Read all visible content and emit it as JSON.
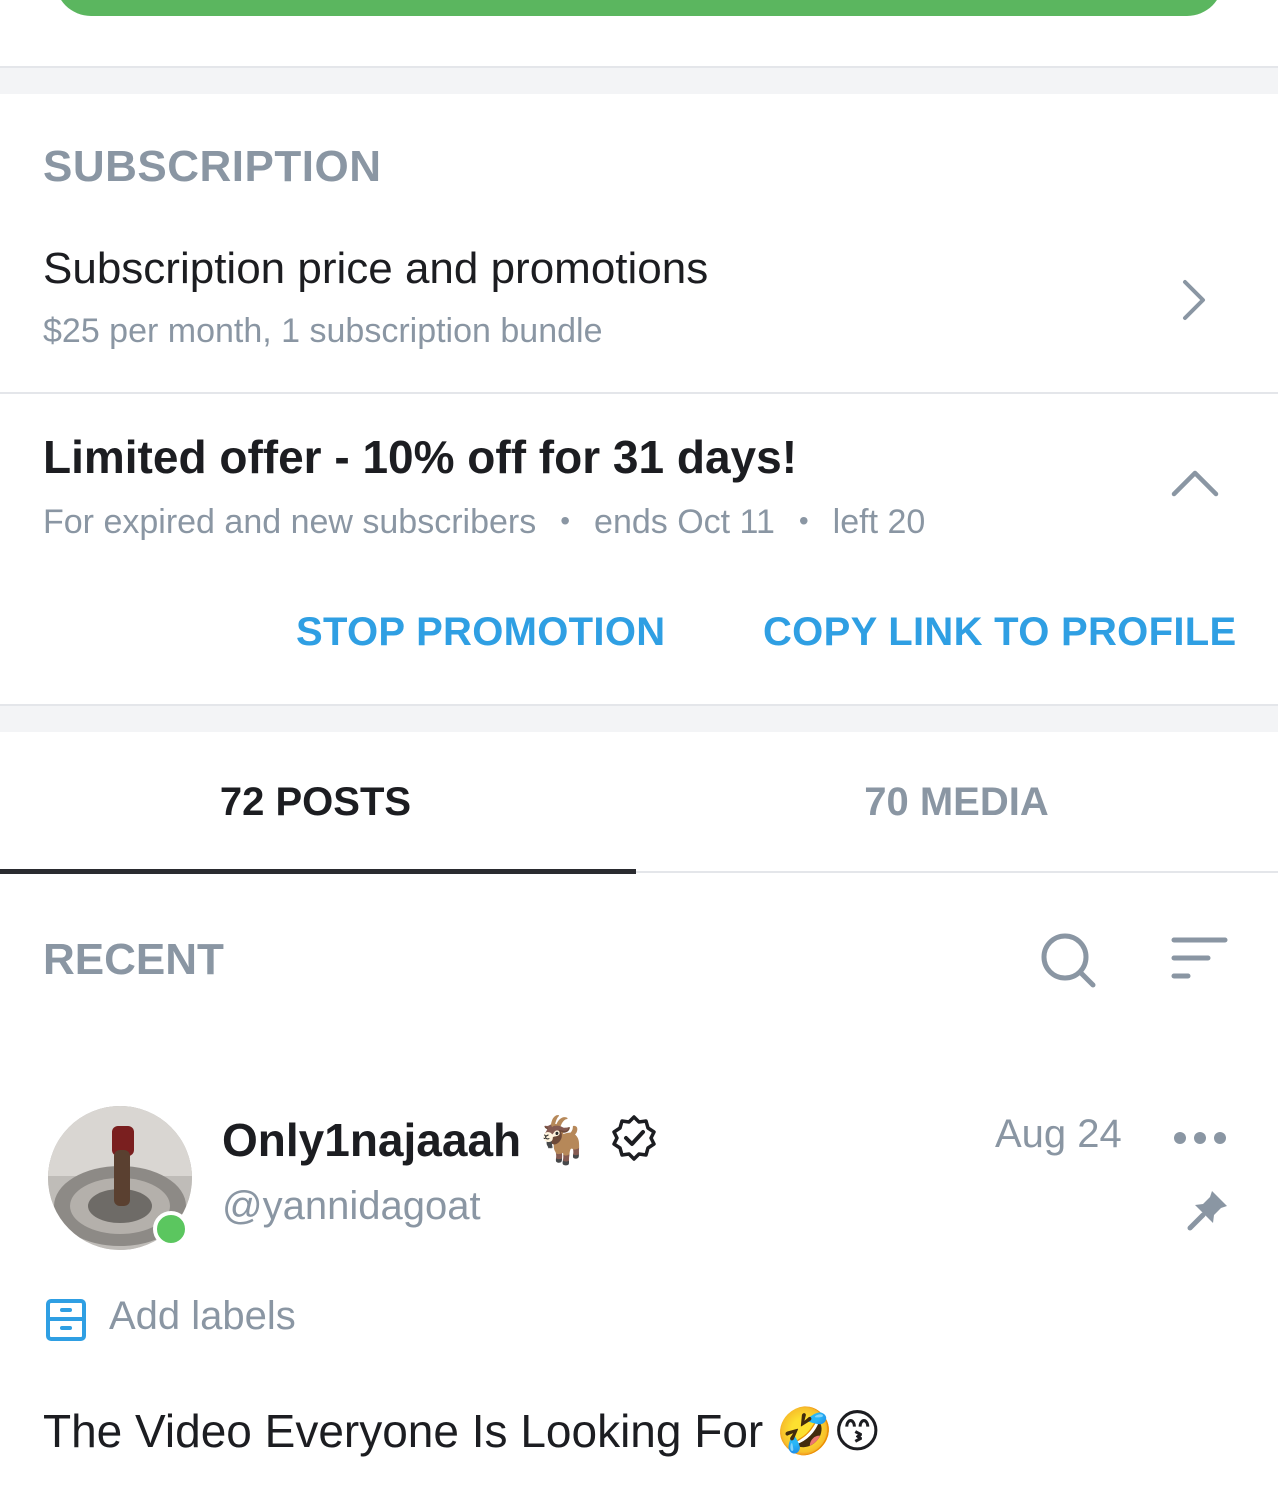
{
  "subscription": {
    "section_title": "SUBSCRIPTION",
    "price_row_title": "Subscription price and promotions",
    "price_row_subtitle": "$25 per month, 1 subscription bundle"
  },
  "promotion": {
    "title": "Limited offer - 10% off for 31 days!",
    "audience": "For expired and new subscribers",
    "ends": "ends Oct 11",
    "left": "left 20",
    "stop_label": "STOP PROMOTION",
    "copy_link_label": "COPY LINK TO PROFILE"
  },
  "tabs": [
    {
      "label": "72 POSTS",
      "active": true
    },
    {
      "label": "70 MEDIA",
      "active": false
    }
  ],
  "feed": {
    "section_label": "RECENT"
  },
  "post": {
    "display_name": "Only1najaaah",
    "name_emoji": "🐐",
    "handle": "@yannidagoat",
    "date": "Aug 24",
    "add_labels_label": "Add labels",
    "text": "The Video Everyone Is Looking For",
    "text_emojis": "🤣😙"
  },
  "colors": {
    "accent_blue": "#2f9fe3",
    "muted_gray": "#8a96a3",
    "online_green": "#5bc65f",
    "top_button_green": "#5bb65f"
  },
  "icons": [
    "chevron-right-icon",
    "chevron-up-icon",
    "search-icon",
    "sort-icon",
    "verified-badge-icon",
    "more-icon",
    "pin-icon",
    "labels-icon"
  ]
}
